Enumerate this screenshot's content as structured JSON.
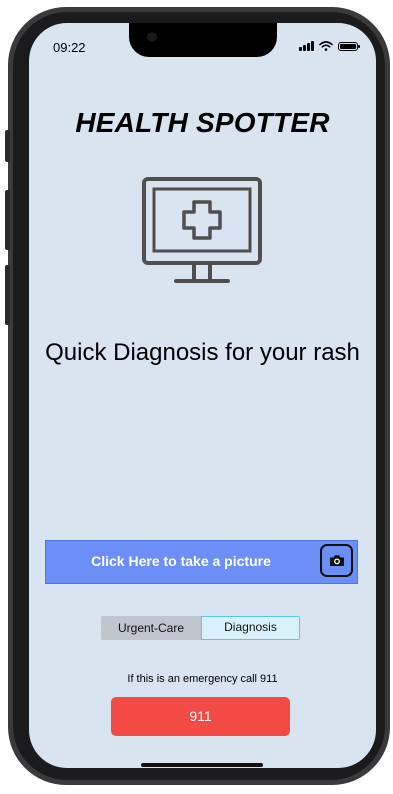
{
  "status_bar": {
    "time": "09:22",
    "icons": [
      "signal-icon",
      "wifi-icon",
      "battery-icon"
    ]
  },
  "app": {
    "title": "HEALTH SPOTTER",
    "hero_icon": "monitor-medical-cross-icon",
    "tagline": "Quick Diagnosis for your rash"
  },
  "picture": {
    "label": "Click Here to take a picture",
    "icon": "camera-icon"
  },
  "tabs": [
    {
      "label": "Urgent-Care",
      "selected": false
    },
    {
      "label": "Diagnosis",
      "selected": true
    }
  ],
  "emergency": {
    "text": "If this is an emergency call 911",
    "button_label": "911"
  },
  "colors": {
    "screen_background": "#d8e4ef",
    "picture_bar": "#6b8ff7",
    "emergency_button": "#f44a45",
    "selected_tab_border": "#5bc5e8"
  }
}
